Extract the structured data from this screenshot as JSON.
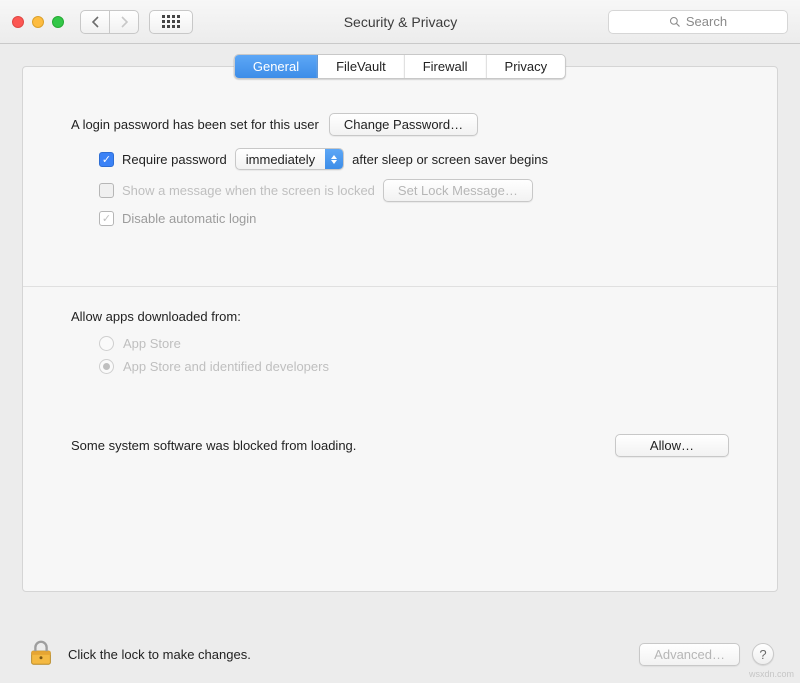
{
  "toolbar": {
    "title": "Security & Privacy",
    "search_placeholder": "Search"
  },
  "tabs": {
    "general": "General",
    "filevault": "FileVault",
    "firewall": "Firewall",
    "privacy": "Privacy"
  },
  "general": {
    "login_password_set": "A login password has been set for this user",
    "change_password_btn": "Change Password…",
    "require_password_label": "Require password",
    "require_password_delay": "immediately",
    "require_password_after": "after sleep or screen saver begins",
    "show_lock_message_label": "Show a message when the screen is locked",
    "set_lock_message_btn": "Set Lock Message…",
    "disable_auto_login_label": "Disable automatic login",
    "allow_apps_heading": "Allow apps downloaded from:",
    "allow_apps_opt1": "App Store",
    "allow_apps_opt2": "App Store and identified developers",
    "blocked_text": "Some system software was blocked from loading.",
    "allow_btn": "Allow…"
  },
  "bottom": {
    "lock_text": "Click the lock to make changes.",
    "advanced_btn": "Advanced…"
  },
  "watermark": "wsxdn.com"
}
